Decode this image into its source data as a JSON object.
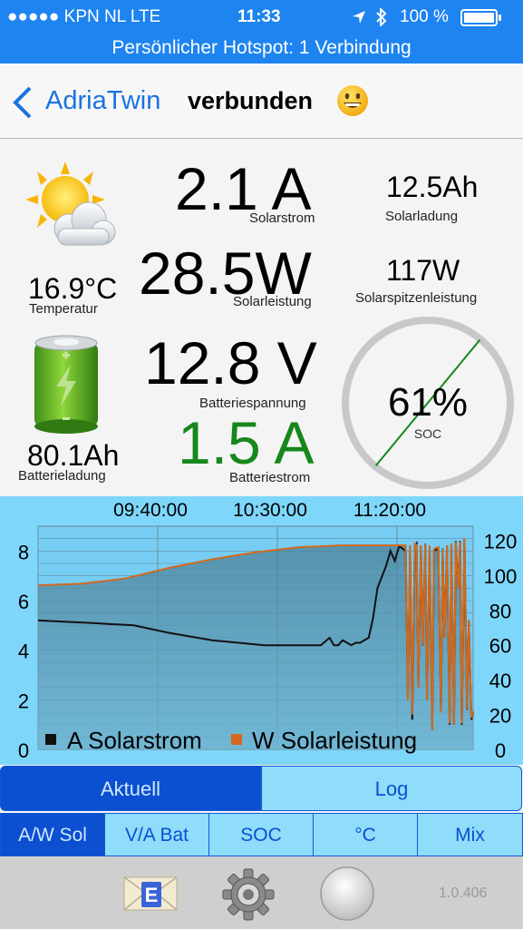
{
  "status_bar": {
    "carrier": "●●●●● KPN NL   LTE",
    "time": "11:33",
    "battery": "100 %"
  },
  "hotspot_banner": "Persönlicher Hotspot: 1 Verbindung",
  "nav": {
    "back_label": "AdriaTwin",
    "title": "verbunden"
  },
  "readings": {
    "temperature_value": "16.9°C",
    "temperature_label": "Temperatur",
    "battery_charge_value": "80.1Ah",
    "battery_charge_label": "Batterieladung",
    "solar_current_value": "2.1 A",
    "solar_current_label": "Solarstrom",
    "solar_power_value": "28.5W",
    "solar_power_label": "Solarleistung",
    "battery_voltage_value": "12.8 V",
    "battery_voltage_label": "Batteriespannung",
    "battery_current_value": "1.5 A",
    "battery_current_label": "Batteriestrom",
    "solar_charge_value": "12.5Ah",
    "solar_charge_label": "Solarladung",
    "solar_peak_value": "117W",
    "solar_peak_label": "Solarspitzenleistung",
    "soc_value": "61%",
    "soc_label": "SOC",
    "soc_fraction": 0.61
  },
  "colors": {
    "accent": "#1d84f0",
    "battery_current": "#16871a",
    "solar_current_line": "#111111",
    "solar_power_line": "#d2691e"
  },
  "chart_data": {
    "type": "line",
    "x_tick_labels": [
      "09:40:00",
      "10:30:00",
      "11:20:00"
    ],
    "y_left_ticks": [
      "0",
      "2",
      "4",
      "6",
      "8"
    ],
    "y_left_range": [
      0,
      9
    ],
    "y_right_ticks": [
      "0",
      "20",
      "40",
      "60",
      "80",
      "100",
      "120"
    ],
    "y_right_range": [
      0,
      128
    ],
    "x_range": [
      0,
      100
    ],
    "series": [
      {
        "name": "A Solarstrom",
        "axis": "left",
        "x": [
          0,
          12,
          22,
          30,
          40,
          52,
          60,
          65,
          67,
          68,
          69,
          70,
          72,
          73,
          74,
          76,
          77,
          78,
          80,
          81,
          82,
          83,
          84.5,
          85,
          85.5,
          86,
          86.6,
          87,
          87.4,
          88,
          88.4,
          89,
          89.4,
          90,
          90.6,
          91,
          92,
          92.6,
          93,
          93.4,
          94,
          94.6,
          95,
          95.6,
          96,
          96.6,
          97,
          97.4,
          98,
          98.6,
          99,
          99.6,
          100
        ],
        "y": [
          5.2,
          5.1,
          5.0,
          4.7,
          4.4,
          4.2,
          4.2,
          4.2,
          4.5,
          4.2,
          4.2,
          4.4,
          4.2,
          4.3,
          4.3,
          4.5,
          5.3,
          6.5,
          7.4,
          8.0,
          7.6,
          8.2,
          8.0,
          2.0,
          8.1,
          1.2,
          8.2,
          8.3,
          2.5,
          8.2,
          4.2,
          8.3,
          2.0,
          8.2,
          0.8,
          8.0,
          8.1,
          1.5,
          8.1,
          4.5,
          8.2,
          1.0,
          8.3,
          1.0,
          8.4,
          6.5,
          8.4,
          1.0,
          8.5,
          1.6,
          5.2,
          1.2,
          1.5
        ]
      },
      {
        "name": "W Solarleistung",
        "axis": "right",
        "x": [
          0,
          10,
          20,
          30,
          40,
          50,
          60,
          70,
          78,
          84.5,
          85,
          85.5,
          86,
          86.6,
          87,
          87.4,
          88,
          88.4,
          89,
          89.4,
          90,
          90.6,
          91,
          92,
          92.6,
          93,
          93.4,
          94,
          94.6,
          95,
          95.6,
          96,
          96.6,
          97,
          97.4,
          98,
          98.6,
          99,
          99.6,
          100
        ],
        "y": [
          94,
          95,
          98,
          104,
          109,
          113,
          116,
          117,
          117,
          117,
          28,
          117,
          20,
          118,
          117,
          35,
          117,
          60,
          118,
          28,
          117,
          11,
          115,
          116,
          21,
          115,
          64,
          117,
          15,
          118,
          14,
          119,
          92,
          119,
          15,
          121,
          23,
          74,
          18,
          22
        ]
      }
    ]
  },
  "tabs": {
    "current": "Aktuell",
    "log": "Log"
  },
  "mode_buttons": [
    "A/W Sol",
    "V/A Bat",
    "SOC",
    "°C",
    "Mix"
  ],
  "bottom": {
    "version": "1.0.406",
    "email_letter": "E"
  }
}
